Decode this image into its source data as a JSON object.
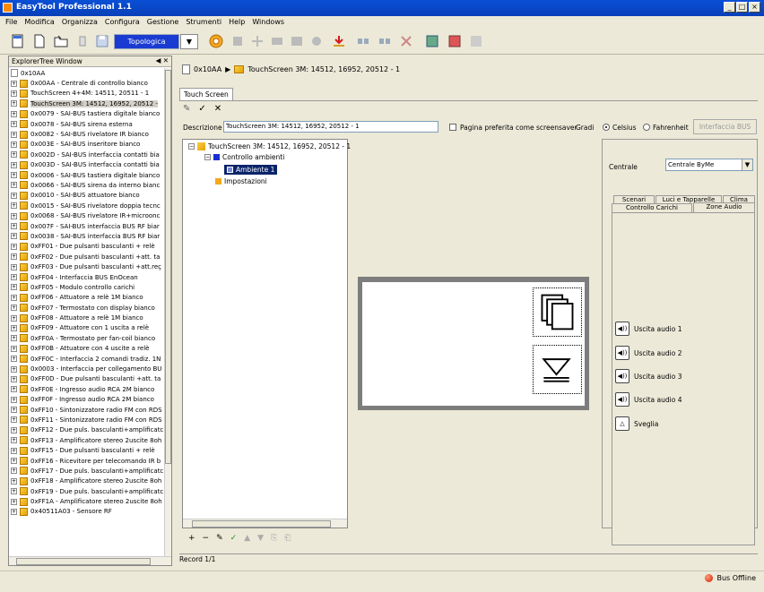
{
  "app": {
    "title": "EasyTool Professional 1.1"
  },
  "menu": [
    "File",
    "Modifica",
    "Organizza",
    "Configura",
    "Gestione",
    "Strumenti",
    "Help",
    "Windows"
  ],
  "toolbar": {
    "view_select": "Topologica",
    "view_dropdown_glyph": "▼"
  },
  "explorer": {
    "title": "ExplorerTree Window",
    "controls": "◀ ✕",
    "items": [
      "0x10AA",
      "0x00AA - Centrale di controllo bianco",
      "TouchScreen 4+4M: 14511, 20511 - 1",
      "TouchScreen 3M: 14512, 16952, 20512 -",
      "0x0079 - SAI-BUS tastiera digitale bianco",
      "0x0078 - SAI-BUS sirena esterna",
      "0x0082 - SAI-BUS rivelatore IR bianco",
      "0x003E - SAI-BUS inseritore bianco",
      "0x002D - SAI-BUS interfaccia contatti bia",
      "0x003D - SAI-BUS interfaccia contatti bia",
      "0x0006 - SAI-BUS tastiera digitale bianco",
      "0x0066 - SAI-BUS sirena da interno bianc",
      "0x0010 - SAI-BUS attuatore bianco",
      "0x0015 - SAI-BUS rivelatore doppia tecnc",
      "0x0068 - SAI-BUS rivelatore IR+microonc",
      "0x007F - SAI-BUS interfaccia BUS RF biar",
      "0x0038 - SAI-BUS interfaccia BUS RF biar",
      "0xFF01 - Due pulsanti basculanti + relè",
      "0xFF02 - Due pulsanti basculanti +att. ta",
      "0xFF03 - Due pulsanti basculanti +att.reç",
      "0xFF04 - Interfaccia BUS EnOcean",
      "0xFF05 - Modulo controllo carichi",
      "0xFF06 - Attuatore a relè 1M bianco",
      "0xFF07 - Termostato con display bianco",
      "0xFF08 - Attuatore a relè 1M bianco",
      "0xFF09 - Attuatore con 1 uscita a relè",
      "0xFF0A - Termostato per fan-coil bianco",
      "0xFF0B - Attuatore con 4 uscite a relè",
      "0xFF0C - Interfaccia 2 comandi tradiz. 1N",
      "0x0003 - Interfaccia per collegamento BU",
      "0xFF0D - Due pulsanti basculanti +att. ta",
      "0xFF0E - Ingresso audio RCA 2M bianco",
      "0xFF0F - Ingresso audio RCA 2M bianco",
      "0xFF10 - Sintonizzatore radio FM con RDS",
      "0xFF11 - Sintonizzatore radio FM con RDS",
      "0xFF12 - Due puls. basculanti+amplificatc",
      "0xFF13 - Amplificatore stereo 2uscite 8oh",
      "0xFF15 - Due pulsanti basculanti + relè",
      "0xFF16 - Ricevitore per telecomando IR b",
      "0xFF17 - Due puls. basculanti+amplificatc",
      "0xFF18 - Amplificatore stereo 2uscite 8oh",
      "0xFF19 - Due puls. basculanti+amplificatc",
      "0xFF1A - Amplificatore stereo 2uscite 8oh",
      "0x40511A03 - Sensore RF"
    ]
  },
  "main": {
    "breadcrumb": {
      "root": "0x10AA",
      "sep": "▶",
      "item": "TouchScreen 3M: 14512, 16952, 20512 - 1"
    },
    "tab": "Touch Screen",
    "actions": {
      "edit": "✎",
      "confirm": "✓",
      "cancel": "✕"
    },
    "description_label": "Descrizione",
    "description_value": "TouchScreen 3M: 14512, 16952, 20512 - 1",
    "screensaver_label": "Pagina preferita come screensaver",
    "gradi_label": "Gradi",
    "celsius": "Celsius",
    "fahrenheit": "Fahrenheit",
    "bus_button": "Interfaccia BUS",
    "tree": {
      "root": "TouchScreen 3M: 14512, 16952, 20512 - 1",
      "controllo": "Controllo ambienti",
      "ambiente": "Ambiente 1",
      "impostazioni": "Impostazioni"
    },
    "bottom_tools": [
      "+",
      "−",
      "✎",
      "✓",
      "▲",
      "▼",
      "⎘",
      "⎗"
    ],
    "record": "Record 1/1"
  },
  "right": {
    "centrale_label": "Centrale",
    "centrale_value": "Centrale ByMe",
    "tabs_row1": [
      "Scenari",
      "Luci e Tapparelle",
      "Clima"
    ],
    "tabs_row2": [
      "Controllo Carichi",
      "Zone Audio"
    ],
    "audio": [
      "Uscita audio 1",
      "Uscita audio 2",
      "Uscita audio 3",
      "Uscita audio 4",
      "Sveglia"
    ]
  },
  "status": {
    "bus": "Bus Offline"
  }
}
